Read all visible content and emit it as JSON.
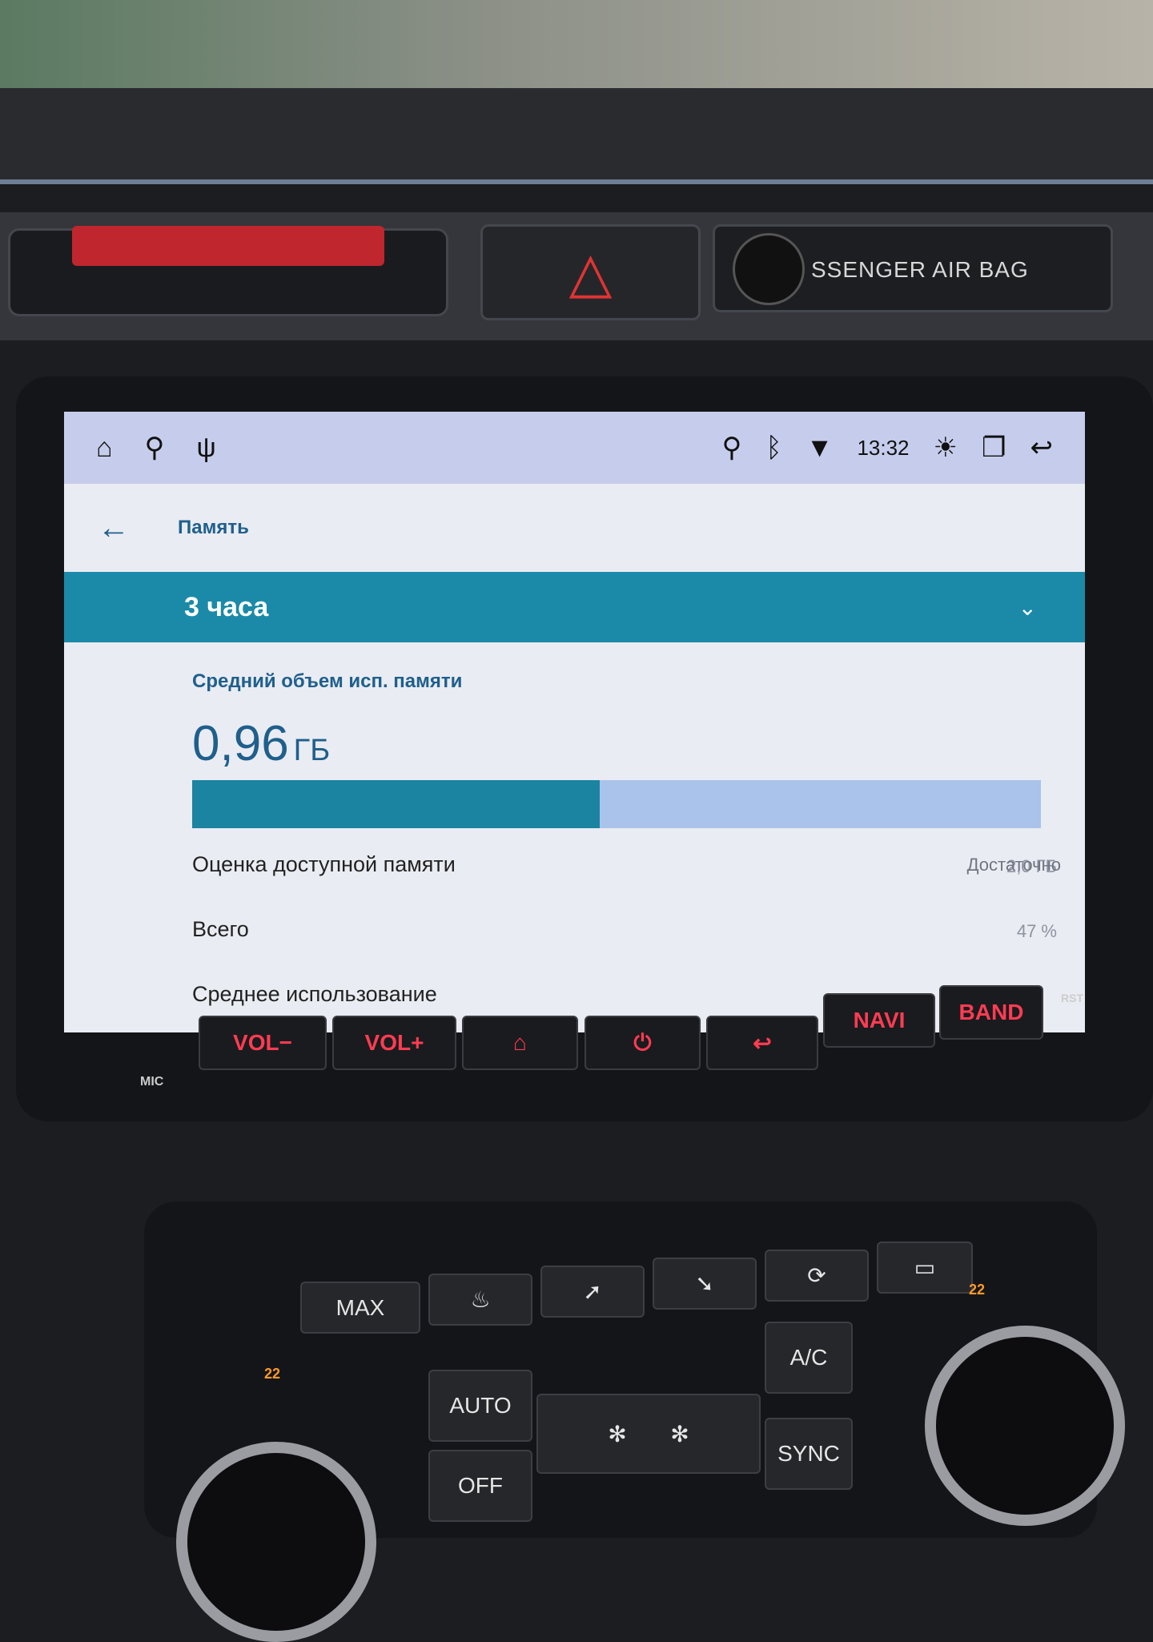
{
  "car": {
    "airbag_label": "SSENGER AIR BAG",
    "hazard_icon": "hazard-triangle-icon",
    "hardware_buttons": [
      {
        "label": "MIC"
      },
      {
        "label": "VOL−"
      },
      {
        "label": "VOL+"
      },
      {
        "label": "⌂",
        "icon": "home-icon"
      },
      {
        "label": "⏻",
        "icon": "power-icon"
      },
      {
        "label": "↩",
        "icon": "back-icon"
      },
      {
        "label": "NAVI"
      },
      {
        "label": "BAND"
      },
      {
        "label": "RST"
      }
    ],
    "climate": {
      "max_label": "MAX",
      "auto_label": "AUTO",
      "off_label": "OFF",
      "ac_label": "A/C",
      "sync_label": "SYNC",
      "left_temp": "22",
      "right_temp": "22"
    },
    "accent_color": "#ff3c52"
  },
  "statusbar": {
    "time": "13:32",
    "icons": [
      "home-icon",
      "location-icon",
      "usb-icon",
      "location-icon",
      "bluetooth-icon",
      "wifi-icon",
      "brightness-icon",
      "recent-apps-icon",
      "back-icon"
    ]
  },
  "appbar": {
    "title": "Память"
  },
  "spinner": {
    "value": "3 часа"
  },
  "memory": {
    "subtitle": "Средний объем исп. памяти",
    "value": "0,96",
    "unit": "ГБ",
    "usage_fraction": 0.48,
    "status": "Достаточно",
    "rows": [
      {
        "label": "Оценка доступной памяти",
        "value": ""
      },
      {
        "label": "Всего",
        "value": "2,0 ГБ"
      },
      {
        "label": "Среднее использование",
        "value": "47 %"
      }
    ]
  },
  "colors": {
    "teal": "#1b8aa8",
    "bar_bg": "#a9c3ea",
    "statusbar": "#c6cdec"
  }
}
